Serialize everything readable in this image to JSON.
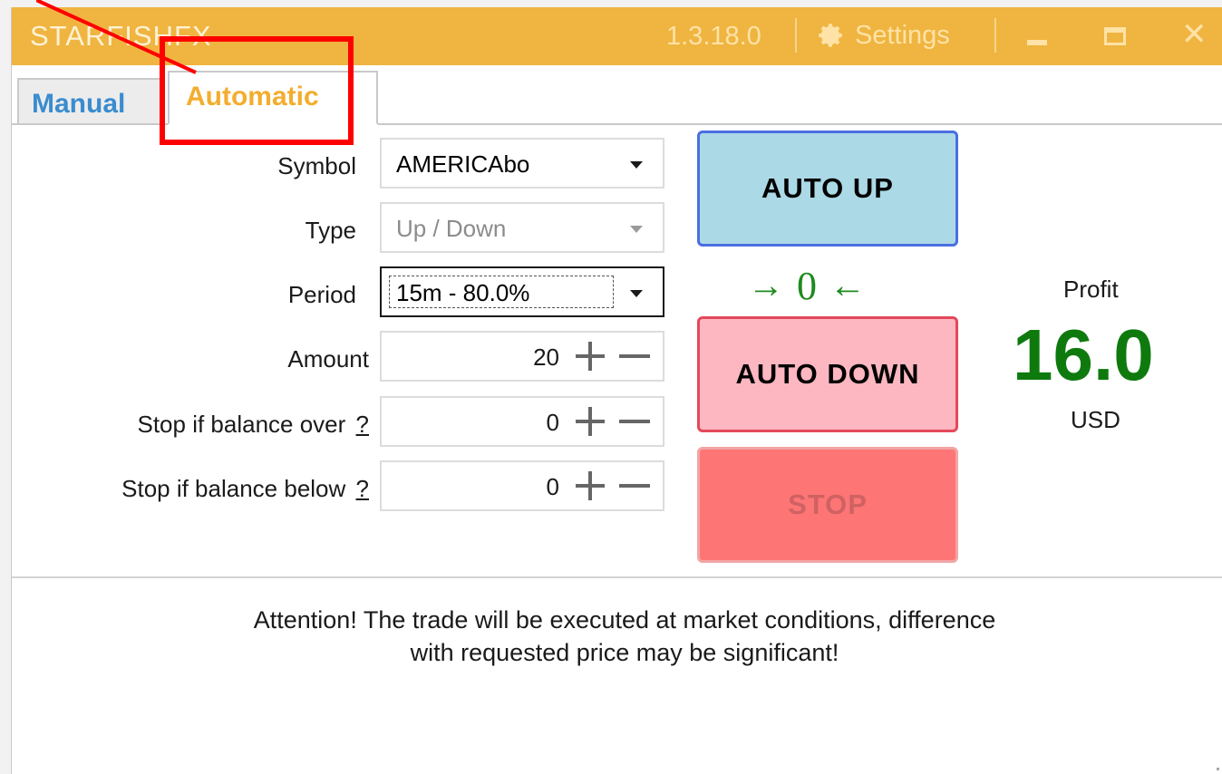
{
  "titlebar": {
    "app_title": "STARFISHFX",
    "version": "1.3.18.0",
    "settings_label": "Settings"
  },
  "tabs": [
    {
      "label": "Manual"
    },
    {
      "label": "Automatic"
    }
  ],
  "form": {
    "symbol_label": "Symbol",
    "symbol_value": "AMERICAbo",
    "type_label": "Type",
    "type_value": "Up / Down",
    "period_label": "Period",
    "period_value": "15m - 80.0%",
    "amount_label": "Amount",
    "amount_value": "20",
    "stop_over_label": "Stop if balance over",
    "stop_over_value": "0",
    "stop_below_label": "Stop if balance below",
    "stop_below_value": "0",
    "help_mark": "?"
  },
  "buttons": {
    "auto_up": "AUTO UP",
    "auto_down": "AUTO DOWN",
    "stop": "STOP"
  },
  "counter": {
    "left_arrow": "→",
    "value": "0",
    "right_arrow": "←"
  },
  "profit": {
    "label": "Profit",
    "value": "16.0",
    "currency": "USD"
  },
  "attention": {
    "line1": "Attention! The trade will be executed at market conditions, difference",
    "line2": "with requested price may be significant!"
  },
  "colors": {
    "titlebar": "#efb540",
    "auto_up_bg": "#acd9e6",
    "auto_down_bg": "#fdb7c1",
    "stop_bg": "#fe7575",
    "profit": "#0e7a0e",
    "annotation": "#ff0000"
  }
}
